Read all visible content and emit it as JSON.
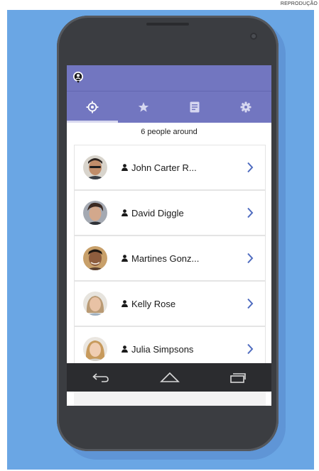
{
  "credit": "REPRODUÇÃO",
  "header": {
    "logo_icon": "location-pin-icon",
    "accent": "#7276c0"
  },
  "tabs": [
    {
      "icon": "locate-target-icon",
      "active": true
    },
    {
      "icon": "star-icon",
      "active": false
    },
    {
      "icon": "notes-icon",
      "active": false
    },
    {
      "icon": "gear-icon",
      "active": false
    }
  ],
  "main": {
    "count_label": "6 people around",
    "people": [
      {
        "name": "John Carter R...",
        "avatar": "avatar-1"
      },
      {
        "name": "David Diggle",
        "avatar": "avatar-2"
      },
      {
        "name": "Martines Gonz...",
        "avatar": "avatar-3"
      },
      {
        "name": "Kelly Rose",
        "avatar": "avatar-4"
      },
      {
        "name": "Julia Simpsons",
        "avatar": "avatar-5"
      }
    ]
  },
  "navbar": {
    "back_icon": "back-arrow-icon",
    "home_icon": "home-icon",
    "recents_icon": "recents-icon"
  }
}
